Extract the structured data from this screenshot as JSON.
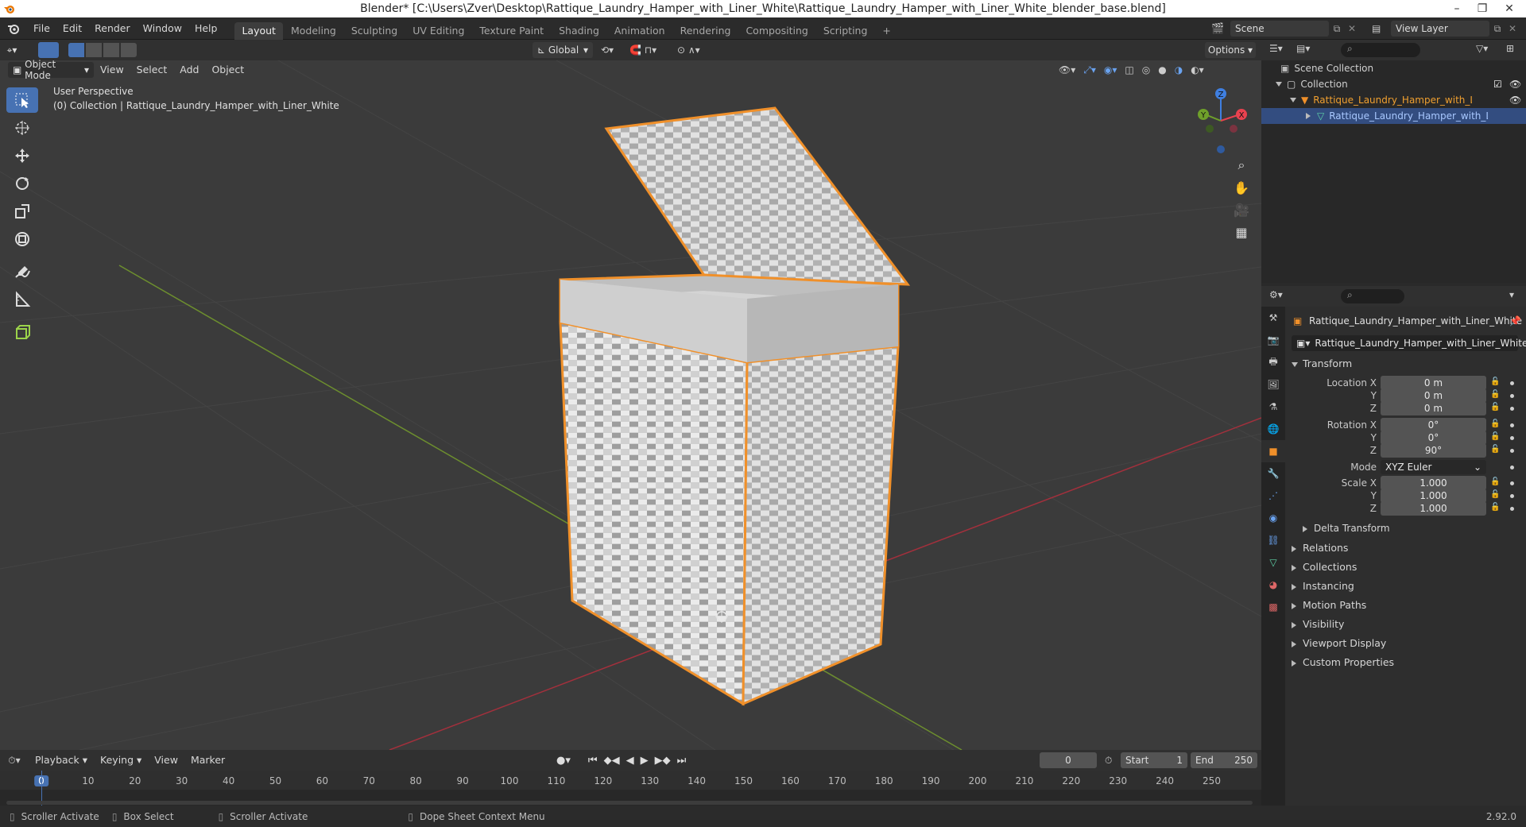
{
  "window": {
    "title": "Blender* [C:\\Users\\Zver\\Desktop\\Rattique_Laundry_Hamper_with_Liner_White\\Rattique_Laundry_Hamper_with_Liner_White_blender_base.blend]",
    "minimize": "–",
    "restore": "❐",
    "close": "✕"
  },
  "menu": {
    "items": [
      "File",
      "Edit",
      "Render",
      "Window",
      "Help"
    ],
    "workspaces": [
      "Layout",
      "Modeling",
      "Sculpting",
      "UV Editing",
      "Texture Paint",
      "Shading",
      "Animation",
      "Rendering",
      "Compositing",
      "Scripting"
    ],
    "active_workspace": "Layout",
    "add_workspace": "+",
    "scene": "Scene",
    "view_layer": "View Layer"
  },
  "viewport_header": {
    "mode": "Object Mode",
    "menus": [
      "View",
      "Select",
      "Add",
      "Object"
    ],
    "orientation": "Global",
    "options": "Options"
  },
  "viewport": {
    "perspective": "User Perspective",
    "collection_info": "(0) Collection | Rattique_Laundry_Hamper_with_Liner_White",
    "gizmo": {
      "x": "X",
      "y": "Y",
      "z": "Z"
    }
  },
  "outliner": {
    "rows": [
      {
        "label": "Scene Collection"
      },
      {
        "label": "Collection"
      },
      {
        "label": "Rattique_Laundry_Hamper_with_Liner_W"
      },
      {
        "label": "Rattique_Laundry_Hamper_with_Lin"
      }
    ]
  },
  "properties": {
    "object_name": "Rattique_Laundry_Hamper_with_Liner_White",
    "datablock": "Rattique_Laundry_Hamper_with_Liner_White",
    "transform_title": "Transform",
    "location": {
      "label": "Location X",
      "x": "0 m",
      "y": "0 m",
      "z": "0 m"
    },
    "rotation": {
      "label": "Rotation X",
      "x": "0°",
      "y": "0°",
      "z": "90°"
    },
    "mode_label": "Mode",
    "mode_value": "XYZ Euler",
    "scale": {
      "label": "Scale X",
      "x": "1.000",
      "y": "1.000",
      "z": "1.000"
    },
    "axis_y": "Y",
    "axis_z": "Z",
    "delta_transform": "Delta Transform",
    "sections": [
      "Relations",
      "Collections",
      "Instancing",
      "Motion Paths",
      "Visibility",
      "Viewport Display",
      "Custom Properties"
    ]
  },
  "timeline": {
    "menus": [
      "Playback",
      "Keying",
      "View",
      "Marker"
    ],
    "current_frame": "0",
    "start_label": "Start",
    "start": "1",
    "end_label": "End",
    "end": "250",
    "ticks": [
      "0",
      "10",
      "20",
      "30",
      "40",
      "50",
      "60",
      "70",
      "80",
      "90",
      "100",
      "110",
      "120",
      "130",
      "140",
      "150",
      "160",
      "170",
      "180",
      "190",
      "200",
      "210",
      "220",
      "230",
      "240",
      "250"
    ]
  },
  "statusbar": {
    "items": [
      "Scroller Activate",
      "Box Select",
      "Scroller Activate",
      "Dope Sheet Context Menu"
    ],
    "version": "2.92.0"
  },
  "colors": {
    "accent": "#4772b3",
    "selection_outline": "#f0902a",
    "axis_x": "#e8424f",
    "axis_y": "#6fa02a",
    "axis_z": "#3f7fe0"
  }
}
